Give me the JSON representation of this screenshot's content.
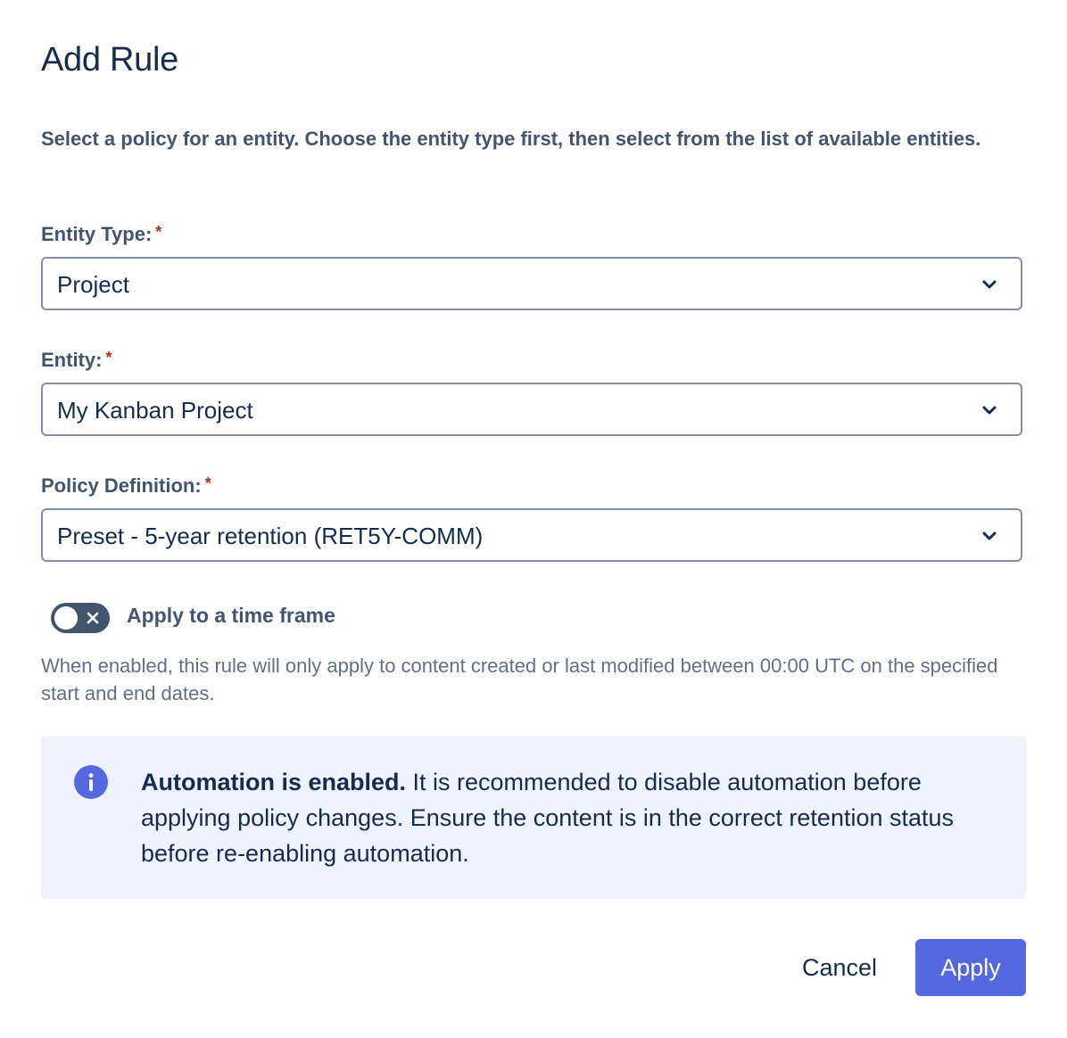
{
  "dialog": {
    "title": "Add Rule",
    "description": "Select a policy for an entity. Choose the entity type first, then select from the list of available entities."
  },
  "fields": {
    "entity_type": {
      "label": "Entity Type:",
      "required_mark": "*",
      "value": "Project"
    },
    "entity": {
      "label": "Entity:",
      "required_mark": "*",
      "value": "My Kanban Project"
    },
    "policy_definition": {
      "label": "Policy Definition:",
      "required_mark": "*",
      "value": "Preset - 5-year retention (RET5Y-COMM)"
    }
  },
  "time_frame": {
    "toggle_label": "Apply to a time frame",
    "enabled": false,
    "helper": "When enabled, this rule will only apply to content created or last modified between 00:00 UTC on the specified start and end dates."
  },
  "info": {
    "icon": "info-icon",
    "bold": "Automation is enabled.",
    "message": " It is recommended to disable automation before applying policy changes. Ensure the content is in the correct retention status before re-enabling automation."
  },
  "actions": {
    "cancel_label": "Cancel",
    "apply_label": "Apply"
  },
  "colors": {
    "primary": "#5468E0",
    "info_background": "#EEF2FD",
    "required": "#AE2E24",
    "toggle_off": "#44546F"
  }
}
